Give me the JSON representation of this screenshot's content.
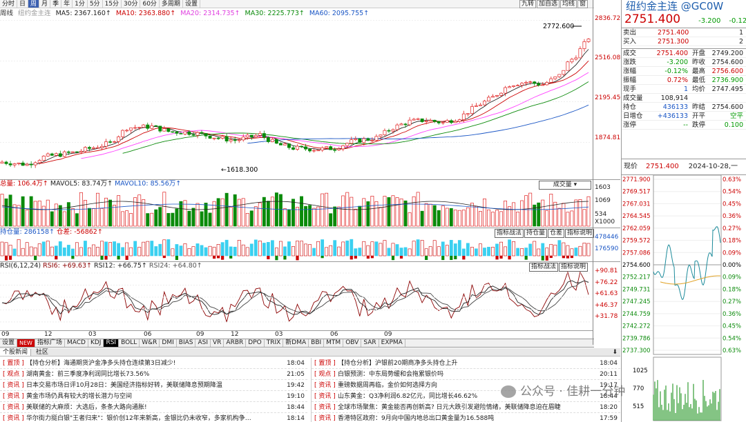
{
  "period_tabs": [
    "分时",
    "日",
    "周",
    "月",
    "季",
    "年",
    "1分",
    "5分",
    "15分",
    "30分",
    "60分",
    "多周期",
    "设置"
  ],
  "period_selected": "周",
  "top_buttons": [
    "九转",
    "加自选",
    "均线",
    "窗"
  ],
  "ma_legend": {
    "period": "周线",
    "name": "纽约金主连",
    "ma5": "MA5: 2367.160↑",
    "ma10": "MA10: 2363.880↑",
    "ma20": "MA20: 2314.735↑",
    "ma30": "MA30: 2225.773↑",
    "ma60": "MA60: 2095.755↑"
  },
  "price_axis": [
    "2836.728",
    "2516.089",
    "2195.450",
    "1874.811"
  ],
  "high_label": "2772.600",
  "low_label": "1618.300",
  "vol_panel": {
    "legend": "总量: 106.4万↑",
    "mavol5": "MAVOL5: 83.74万↑",
    "mavol10": "MAVOL10: 85.56万↑",
    "dropdown": "成交量",
    "axis": [
      "1603",
      "1069",
      "534",
      "X1000"
    ]
  },
  "oi_panel": {
    "legend": "持仓量: 286158↑",
    "diff": "仓差: -56862↑",
    "buttons": [
      "指标战法",
      "持仓量",
      "仓差",
      "指标说明"
    ],
    "axis": [
      "478446",
      "176590"
    ]
  },
  "rsi_panel": {
    "legend": "RSI(6,12,24)",
    "rsi6": "RSI6: +69.63↑",
    "rsi12": "RSI12: +66.75↑",
    "rsi24": "RSI24: +64.80↑",
    "buttons": [
      "指标战法",
      "指标说明"
    ],
    "axis": [
      "+90.81",
      "+76.22",
      "+61.63",
      "+46.37",
      "+31.78"
    ]
  },
  "x_axis": [
    "09",
    "12",
    "03",
    "06",
    "09",
    "12",
    "03",
    "06",
    "09"
  ],
  "indicator_tabs": [
    "设置",
    "NEW",
    "指标广场",
    "MACD",
    "KDJ",
    "RSI",
    "BOLL",
    "W&R",
    "DMI",
    "BIAS",
    "ASI",
    "VR",
    "ARBR",
    "DPO",
    "TRIX",
    "新DMA",
    "BBI",
    "MTM",
    "OBV",
    "SAR",
    "EXPMA"
  ],
  "indicator_selected": "RSI",
  "news_bar": [
    "个股新闻",
    "社区"
  ],
  "news_left": [
    {
      "tag": "置顶",
      "text": "【持仓分析】海通期货沪金净多头持仓连续第3日减少!",
      "time": "18:04"
    },
    {
      "tag": "观点",
      "text": "湖南黄金：前三季度净利润同比增长73.56%",
      "time": "21:05"
    },
    {
      "tag": "资讯",
      "text": "日本交易市场日评10月28日：美国经济指标好转，美联储降息预期降温",
      "time": "19:42"
    },
    {
      "tag": "资讯",
      "text": "黄金市场仍具有较大的增长潜力与空间",
      "time": "19:10"
    },
    {
      "tag": "资讯",
      "text": "美联储的大麻烦：大选后，条条大路向通胀!",
      "time": "18:44"
    },
    {
      "tag": "资讯",
      "text": "华尔街力挺白银\"王者归来\"：银价创12年来新高，金银比仍未收窄，多家机构争…",
      "time": "18:14"
    }
  ],
  "news_right": [
    {
      "tag": "置顶",
      "text": "【持仓分析】沪银前20期商净多头持仓上升",
      "time": "18:04"
    },
    {
      "tag": "观点",
      "text": "白银预测：中东局势缓和会拖累银价吗",
      "time": "20:11"
    },
    {
      "tag": "资讯",
      "text": "重磅数据周再临，金价如何选择方向",
      "time": "19:17"
    },
    {
      "tag": "资讯",
      "text": "山东黄金：Q3净利润6.82亿元，同比增长46.62%",
      "time": "18:44"
    },
    {
      "tag": "资讯",
      "text": "全球市场聚焦：黄金能否再创新高? 日元大跌引发避险情绪，美联储降息迫在眉睫",
      "time": "18:20"
    },
    {
      "tag": "资讯",
      "text": "香港特区政府：9月向中国内地总出口黄金量为16.588吨",
      "time": "17:59"
    }
  ],
  "quote": {
    "title": "纽约金主连 @GC0W",
    "price": "2751.400",
    "change": "-3.200",
    "pct": "-0.12%",
    "ask_label": "卖出",
    "ask": "2751.400",
    "ask_vol": "1",
    "bid_label": "买入",
    "bid": "2751.300",
    "bid_vol": "2",
    "rows": [
      [
        "成交",
        "2751.400",
        "开盘",
        "2749.200"
      ],
      [
        "涨跌",
        "-3.200",
        "昨收",
        "2754.600"
      ],
      [
        "涨幅",
        "-0.12%",
        "最高",
        "2756.600"
      ],
      [
        "振幅",
        "0.72%",
        "最低",
        "2736.900"
      ],
      [
        "现手",
        "1",
        "均价",
        "2747.495"
      ],
      [
        "成交量",
        "108,914",
        "",
        ""
      ],
      [
        "持仓",
        "436133",
        "昨结",
        "2754.600"
      ],
      [
        "日增仓",
        "+436133",
        "开平",
        "空平"
      ],
      [
        "涨停",
        "--",
        "跌停",
        "0.100"
      ]
    ]
  },
  "intraday": {
    "now_label": "现价",
    "now": "2751.400",
    "date": "2024-10-28,一",
    "left_axis": [
      "2771.900",
      "2769.517",
      "2767.031",
      "2764.545",
      "2762.059",
      "2759.572",
      "2757.086",
      "2754.600",
      "2752.217",
      "2749.731",
      "2747.245",
      "2744.759",
      "2742.272",
      "2739.786",
      "2737.300"
    ],
    "right_axis": [
      "0.63%",
      "0.54%",
      "0.45%",
      "0.36%",
      "0.27%",
      "0.18%",
      "0.09%",
      "0.00%",
      "0.09%",
      "0.18%",
      "0.27%",
      "0.36%",
      "0.45%",
      "0.54%",
      "0.63%"
    ],
    "vol_axis": [
      "1025",
      "770",
      "515"
    ]
  },
  "watermark": "公众号 · 佳耕一分钟",
  "colors": {
    "up": "#e02020",
    "down": "#0a8a0a",
    "ma5": "#222222",
    "ma10": "#cc0000",
    "ma20": "#ff40ff",
    "ma30": "#0a8a0a",
    "ma60": "#1a56c5",
    "rsi6": "#8b0000",
    "rsi12": "#222",
    "rsi24": "#444"
  }
}
